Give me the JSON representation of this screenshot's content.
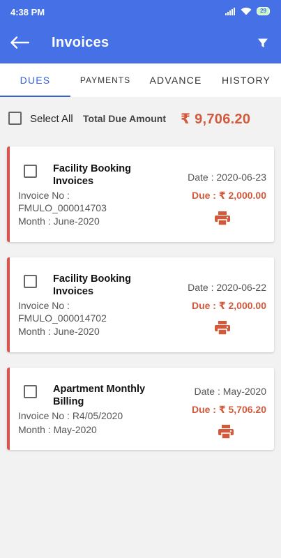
{
  "status_bar": {
    "time": "4:38 PM",
    "battery": "29"
  },
  "header": {
    "title": "Invoices",
    "back_icon": "arrow-left-icon",
    "filter_icon": "filter-icon"
  },
  "tabs": [
    {
      "label": "DUES",
      "active": true
    },
    {
      "label": "PAYMENTS",
      "active": false
    },
    {
      "label": "ADVANCE",
      "active": false
    },
    {
      "label": "HISTORY",
      "active": false
    }
  ],
  "summary": {
    "select_all_label": "Select All",
    "total_label": "Total Due Amount",
    "total_amount": "₹ 9,706.20"
  },
  "invoices": [
    {
      "title": "Facility Booking Invoices",
      "invoice_label": "Invoice No :",
      "invoice_no": "FMULO_000014703",
      "month": "Month : June-2020",
      "date": "Date : 2020-06-23",
      "due": "Due : ₹ 2,000.00"
    },
    {
      "title": "Facility Booking Invoices",
      "invoice_label": "Invoice No :",
      "invoice_no": "FMULO_000014702",
      "month": "Month : June-2020",
      "date": "Date : 2020-06-22",
      "due": "Due : ₹ 2,000.00"
    },
    {
      "title": "Apartment Monthly Billing",
      "invoice_line": "Invoice No : R4/05/2020",
      "month": "Month : May-2020",
      "date": "Date : May-2020",
      "due": "Due : ₹ 5,706.20"
    }
  ],
  "colors": {
    "primary": "#4570e6",
    "accent": "#d15a3c",
    "card_stripe": "#d9534f",
    "tab_active": "#3a64d6"
  }
}
